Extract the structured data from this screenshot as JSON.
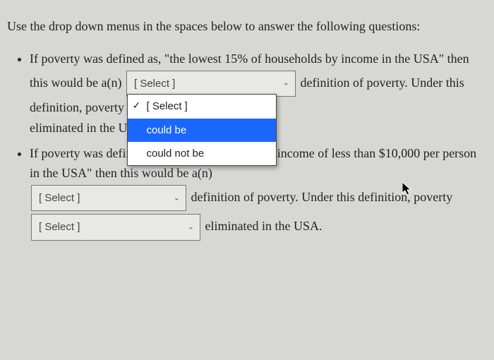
{
  "intro": "Use the drop down menus in the spaces below to answer the following questions:",
  "q1": {
    "part1": "If poverty was defined as, \"the lowest 15% of households by income in the USA\" then this would be a(n)",
    "select1_placeholder": "[ Select ]",
    "after_select1": "definition of poverty. Under this definition, poverty",
    "dropdown": {
      "placeholder": "[ Select ]",
      "opt1": "could be",
      "opt2": "could not be"
    },
    "after_select2": "eliminated in the USA."
  },
  "q2": {
    "part1": "If poverty was defined as, \"households that earn income of less than $10,000 per person in the USA\" then this would be a(n)",
    "select1_placeholder": "[ Select ]",
    "after_select1": "definition of poverty. Under this definition, poverty",
    "select2_placeholder": "[ Select ]",
    "after_select2": "eliminated in the USA."
  },
  "chevron": "⌄"
}
